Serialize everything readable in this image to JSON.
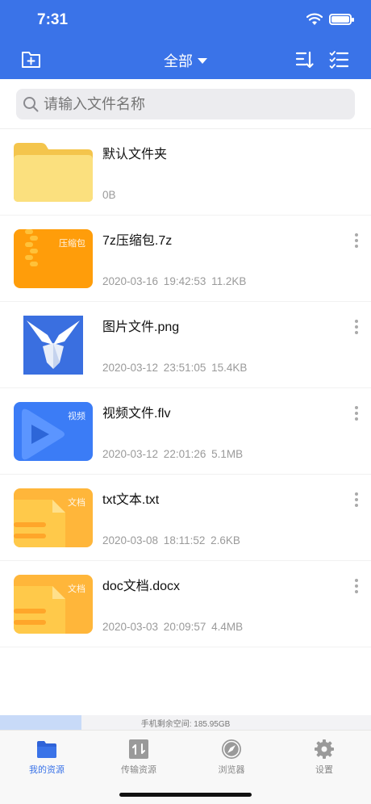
{
  "status": {
    "time": "7:31"
  },
  "header": {
    "title": "全部"
  },
  "search": {
    "placeholder": "请输入文件名称"
  },
  "files": [
    {
      "name": "默认文件夹",
      "meta": "0B",
      "icon": "folder-icon",
      "badge": ""
    },
    {
      "name": "7z压缩包.7z",
      "meta": "2020-03-16 19:42:53  11.2KB",
      "icon": "archive-icon",
      "badge": "压缩包"
    },
    {
      "name": "图片文件.png",
      "meta": "2020-03-12 23:51:05  15.4KB",
      "icon": "image-icon",
      "badge": ""
    },
    {
      "name": "视频文件.flv",
      "meta": "2020-03-12 22:01:26  5.1MB",
      "icon": "video-icon",
      "badge": "视频"
    },
    {
      "name": "txt文本.txt",
      "meta": "2020-03-08 18:11:52  2.6KB",
      "icon": "document-icon",
      "badge": "文档"
    },
    {
      "name": "doc文档.docx",
      "meta": "2020-03-03 20:09:57  4.4MB",
      "icon": "document-icon",
      "badge": "文档"
    }
  ],
  "storage": {
    "label": "手机剩余空间:  185.95GB",
    "used_fraction": 0.22
  },
  "tabs": [
    {
      "label": "我的资源",
      "icon": "folder-icon",
      "active": true
    },
    {
      "label": "传输资源",
      "icon": "transfer-icon",
      "active": false
    },
    {
      "label": "浏览器",
      "icon": "compass-icon",
      "active": false
    },
    {
      "label": "设置",
      "icon": "gear-icon",
      "active": false
    }
  ],
  "colors": {
    "accent": "#3a73e8",
    "folder": "#f7d46a",
    "archive": "#ff9d0a",
    "video": "#3b7cf6",
    "document": "#ffb63a"
  }
}
